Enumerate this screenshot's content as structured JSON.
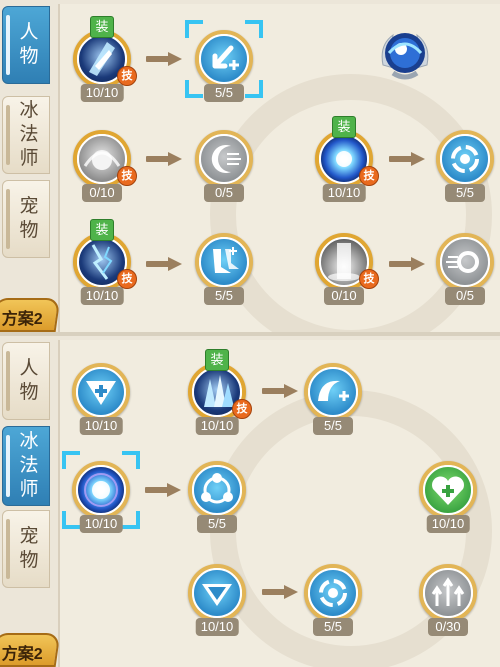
{
  "badges": {
    "equip": "装",
    "skill": "技"
  },
  "top_panel": {
    "tabs": [
      {
        "label": "人\n物",
        "active": true
      },
      {
        "label": "冰\n法\n师",
        "active": false
      },
      {
        "label": "宠\n物",
        "active": false
      }
    ],
    "scheme_label": "方案2",
    "nodes": [
      {
        "id": "ice-shard",
        "count": "10/10",
        "equip": true,
        "skill": true,
        "selected": false
      },
      {
        "id": "arrow-plus",
        "count": "5/5",
        "equip": false,
        "skill": false,
        "selected": true
      },
      {
        "id": "frost-orb",
        "count": "",
        "equip": false,
        "skill": false,
        "selected": false
      },
      {
        "id": "frost-burst",
        "count": "0/10",
        "equip": false,
        "skill": true,
        "selected": false
      },
      {
        "id": "crescent-dash",
        "count": "0/5",
        "equip": false,
        "skill": false,
        "selected": false
      },
      {
        "id": "energy-sphere",
        "count": "10/10",
        "equip": true,
        "skill": true,
        "selected": false
      },
      {
        "id": "vortex",
        "count": "5/5",
        "equip": false,
        "skill": false,
        "selected": false
      },
      {
        "id": "lightning",
        "count": "10/10",
        "equip": true,
        "skill": true,
        "selected": false
      },
      {
        "id": "speed-boots",
        "count": "5/5",
        "equip": false,
        "skill": false,
        "selected": false
      },
      {
        "id": "light-pillar",
        "count": "0/10",
        "equip": false,
        "skill": true,
        "selected": false
      },
      {
        "id": "swirl-ring",
        "count": "0/5",
        "equip": false,
        "skill": false,
        "selected": false
      }
    ]
  },
  "bottom_panel": {
    "tabs": [
      {
        "label": "人\n物",
        "active": false
      },
      {
        "label": "冰\n法\n师",
        "active": true
      },
      {
        "label": "宠\n物",
        "active": false
      }
    ],
    "scheme_label": "方案2",
    "nodes": [
      {
        "id": "heal-shield",
        "count": "10/10",
        "equip": false,
        "skill": false,
        "selected": false
      },
      {
        "id": "ice-crystals",
        "count": "10/10",
        "equip": true,
        "skill": true,
        "selected": false
      },
      {
        "id": "wave-plus",
        "count": "5/5",
        "equip": false,
        "skill": false,
        "selected": false
      },
      {
        "id": "energy-core",
        "count": "10/10",
        "equip": false,
        "skill": false,
        "selected": true
      },
      {
        "id": "team-link",
        "count": "5/5",
        "equip": false,
        "skill": false,
        "selected": false
      },
      {
        "id": "heart-plus",
        "count": "10/10",
        "equip": false,
        "skill": false,
        "selected": false
      },
      {
        "id": "diamond-guard",
        "count": "10/10",
        "equip": false,
        "skill": false,
        "selected": false
      },
      {
        "id": "vortex-2",
        "count": "5/5",
        "equip": false,
        "skill": false,
        "selected": false
      },
      {
        "id": "stat-up",
        "count": "0/30",
        "equip": false,
        "skill": false,
        "selected": false
      }
    ]
  }
}
